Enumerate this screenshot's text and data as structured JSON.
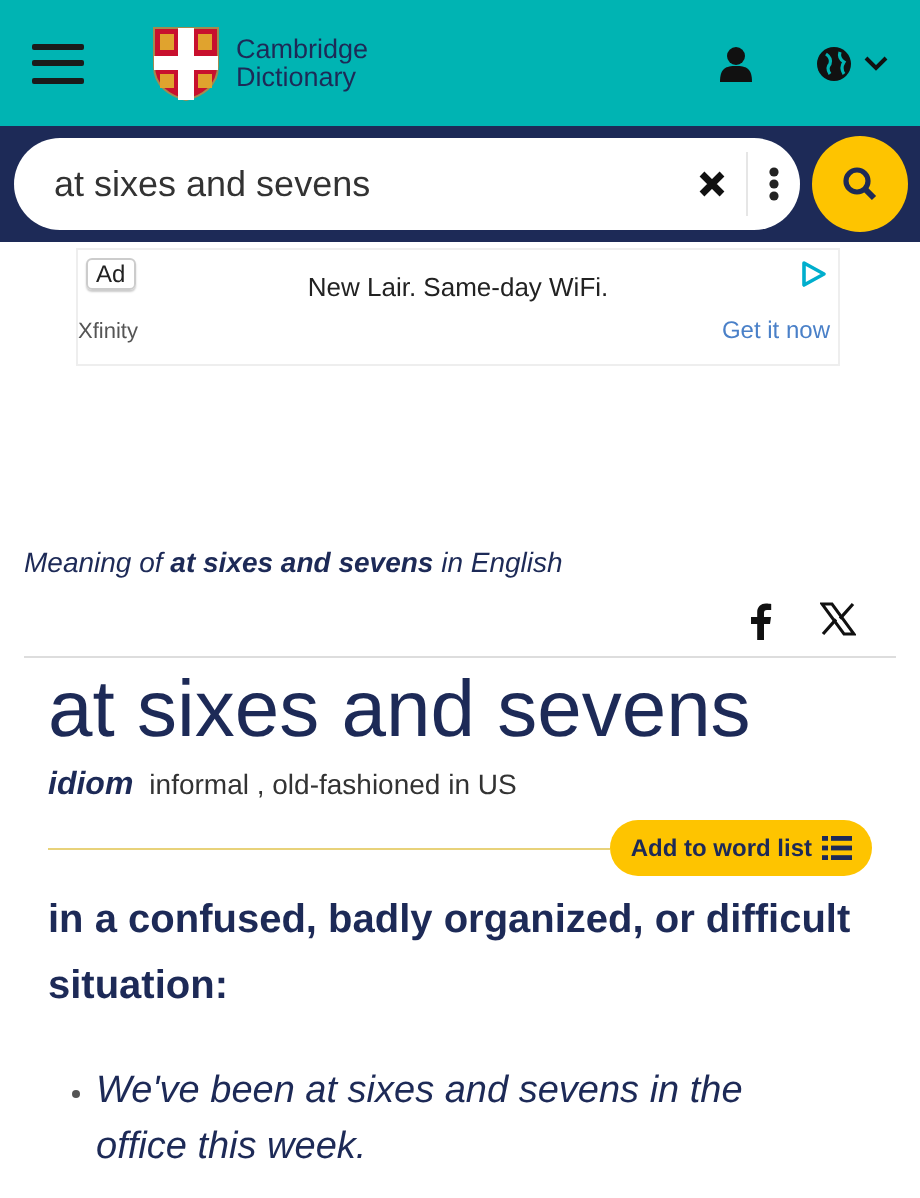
{
  "header": {
    "logo_line_1": "Cambridge",
    "logo_line_2": "Dictionary"
  },
  "search": {
    "value": "at sixes and sevens"
  },
  "ad": {
    "badge": "Ad",
    "headline": "New Lair. Same-day WiFi.",
    "advertiser": "Xfinity",
    "cta": "Get it now"
  },
  "entry": {
    "meaning": "Meaning of **at sixes and sevens** in English",
    "headword": "at sixes and sevens",
    "pos": "idiom",
    "labels": "informal , old-fashioned in US",
    "add_button": "Add to word list",
    "definition": "in a confused, badly organized, or difficult situation:",
    "examples": [
      "We've been at sixes and sevens in the office this week."
    ]
  }
}
